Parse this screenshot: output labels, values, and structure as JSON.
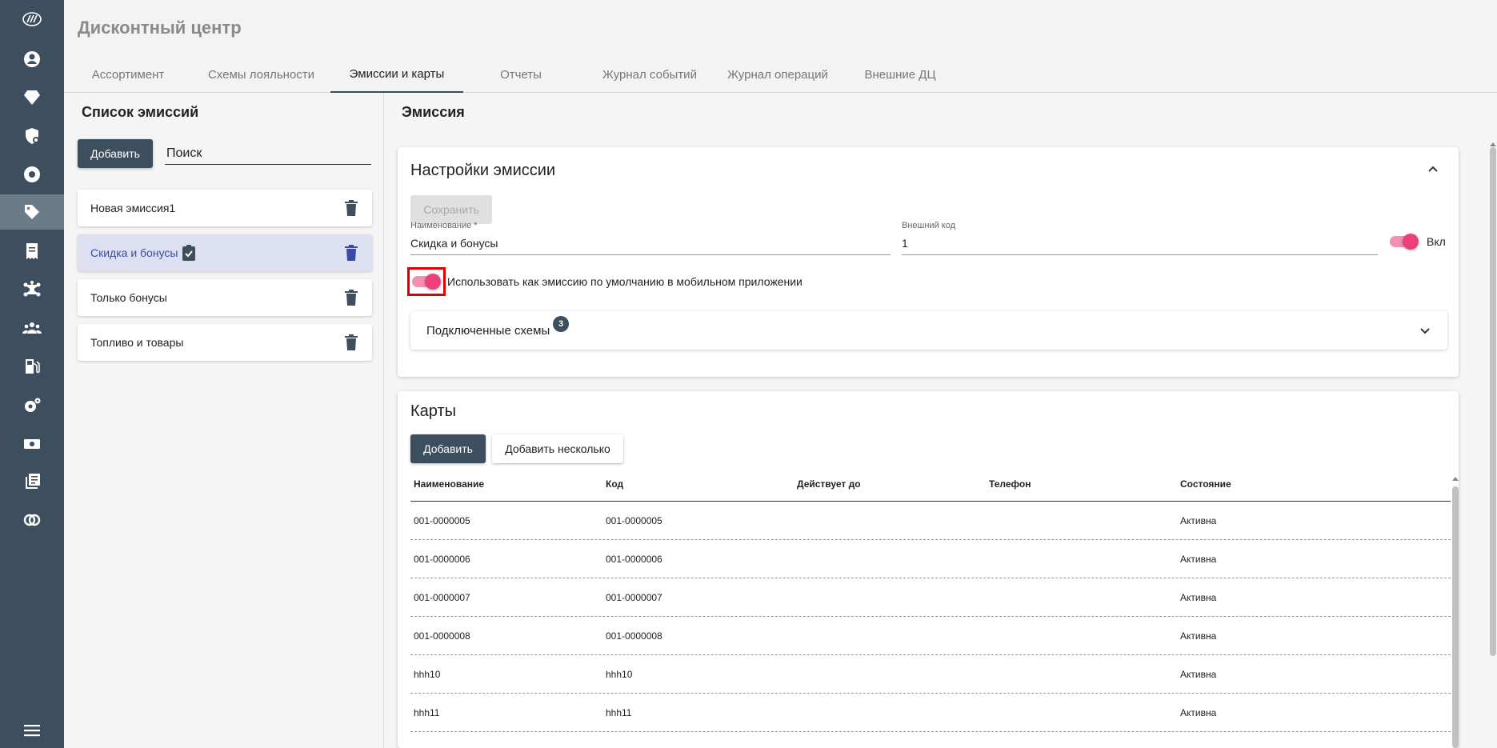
{
  "app": {
    "title": "Дисконтный центр"
  },
  "tabs": [
    {
      "label": "Ассортимент"
    },
    {
      "label": "Схемы лояльности"
    },
    {
      "label": "Эмиссии и карты"
    },
    {
      "label": "Отчеты"
    },
    {
      "label": "Журнал событий"
    },
    {
      "label": "Журнал операций"
    },
    {
      "label": "Внешние ДЦ"
    }
  ],
  "active_tab": "Эмиссии и карты",
  "rail_icons": [
    "logo-icon",
    "user-icon",
    "diamond-icon",
    "shield-settings-icon",
    "lifebuoy-icon",
    "tag-icon",
    "receipt-icon",
    "network-icon",
    "people-icon",
    "fuel-station-icon",
    "gear-icon",
    "cash-icon",
    "list-book-icon",
    "rings-icon",
    "menu-icon"
  ],
  "left": {
    "title": "Список эмиссий",
    "add_label": "Добавить",
    "search_placeholder": "Поиск",
    "items": [
      {
        "label": "Новая эмиссия1",
        "selected": false
      },
      {
        "label": "Скидка и бонусы",
        "selected": true
      },
      {
        "label": "Только бонусы",
        "selected": false
      },
      {
        "label": "Топливо и товары",
        "selected": false
      }
    ]
  },
  "emission": {
    "title": "Эмиссия",
    "settings_title": "Настройки эмиссии",
    "save_label": "Сохранить",
    "name_label": "Наименование *",
    "name_value": "Скидка и бонусы",
    "ext_code_label": "Внешний код",
    "ext_code_value": "1",
    "active_label": "Вкл",
    "active_on": true,
    "default_label": "Использовать как эмиссию по умолчанию в мобильном приложении",
    "default_on": true,
    "schemes_label": "Подключенные схемы",
    "schemes_count": "3"
  },
  "cards": {
    "title": "Карты",
    "add_label": "Добавить",
    "add_multiple_label": "Добавить несколько",
    "columns": [
      "Наименование",
      "Код",
      "Действует до",
      "Телефон",
      "Состояние"
    ],
    "rows": [
      {
        "name": "001-0000005",
        "code": "001-0000005",
        "valid_to": "",
        "phone": "",
        "status": "Активна"
      },
      {
        "name": "001-0000006",
        "code": "001-0000006",
        "valid_to": "",
        "phone": "",
        "status": "Активна"
      },
      {
        "name": "001-0000007",
        "code": "001-0000007",
        "valid_to": "",
        "phone": "",
        "status": "Активна"
      },
      {
        "name": "001-0000008",
        "code": "001-0000008",
        "valid_to": "",
        "phone": "",
        "status": "Активна"
      },
      {
        "name": "hhh10",
        "code": "hhh10",
        "valid_to": "",
        "phone": "",
        "status": "Активна"
      },
      {
        "name": "hhh11",
        "code": "hhh11",
        "valid_to": "",
        "phone": "",
        "status": "Активна"
      }
    ]
  },
  "colors": {
    "rail": "#3d4f5e",
    "accent_toggle": "#ec407a",
    "selected_item": "#dde0f1",
    "highlight": "#e00000"
  }
}
